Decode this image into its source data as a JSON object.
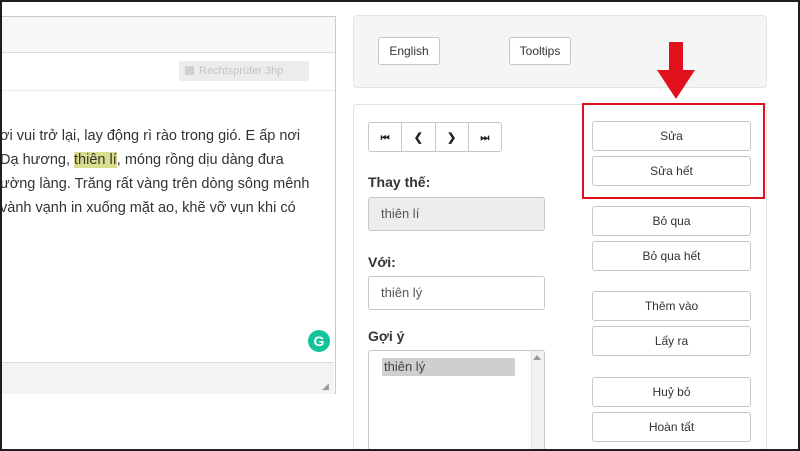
{
  "editor": {
    "ghost_button": "Rechtsprüfer 3hp",
    "lines": [
      {
        "pre": "ơi vui trở lại, lay động rì rào trong gió. E ấp nơi",
        "hl": "",
        "post": ""
      },
      {
        "pre": "Dạ hương, ",
        "hl": "thiên lí",
        "post": ", móng rồng dịu dàng đưa"
      },
      {
        "pre": "ường làng. Trăng rất vàng trên dòng sông mênh",
        "hl": "",
        "post": ""
      },
      {
        "pre": "vành vạnh in xuống mặt ao, khẽ vỡ vụn khi có",
        "hl": "",
        "post": ""
      }
    ],
    "grammarly_letter": "G"
  },
  "top_panel": {
    "english_label": "English",
    "tooltips_label": "Tooltips"
  },
  "nav": {
    "first": "⏮",
    "prev": "❮",
    "next": "❯",
    "last": "⏭"
  },
  "replace": {
    "label": "Thay thế:",
    "value": "thiên lí"
  },
  "with": {
    "label": "Với:",
    "value": "thiên lý"
  },
  "suggestions": {
    "label": "Gợi ý",
    "items": [
      "thiên lý"
    ]
  },
  "actions": {
    "change": "Sửa",
    "change_all": "Sửa hết",
    "ignore": "Bỏ qua",
    "ignore_all": "Bỏ qua hết",
    "add": "Thêm vào",
    "remove": "Lấy ra",
    "cancel": "Huỷ bỏ",
    "done": "Hoàn tất"
  },
  "colors": {
    "highlight_box": "#e0101d",
    "arrow": "#e0101d",
    "word_highlight": "#d9de8d",
    "grammarly": "#15c39a"
  }
}
